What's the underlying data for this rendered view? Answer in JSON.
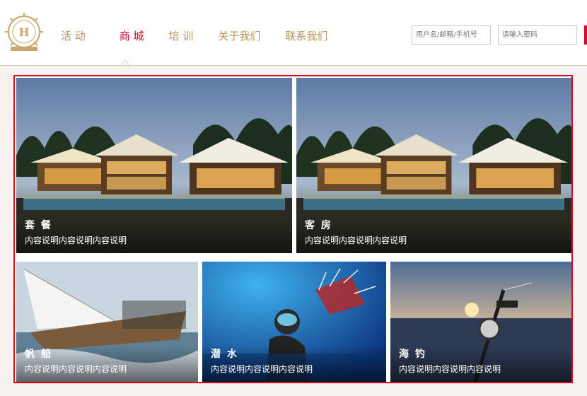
{
  "nav": {
    "items": [
      {
        "label": "活 动",
        "active": false
      },
      {
        "label": "商 城",
        "active": true
      },
      {
        "label": "培 训",
        "active": false
      },
      {
        "label": "关于我们",
        "active": false
      },
      {
        "label": "联系我们",
        "active": false
      }
    ]
  },
  "login": {
    "username_placeholder": "用户名/邮箱/手机号",
    "password_placeholder": "请输入密码"
  },
  "tiles": [
    {
      "title": "套 餐",
      "desc": "内容说明内容说明内容说明"
    },
    {
      "title": "客 房",
      "desc": "内容说明内容说明内容说明"
    },
    {
      "title": "帆 船",
      "desc": "内容说明内容说明内容说明"
    },
    {
      "title": "潜 水",
      "desc": "内容说明内容说明内容说明"
    },
    {
      "title": "海 钓",
      "desc": "内容说明内容说明内容说明"
    }
  ],
  "colors": {
    "accent": "#c8102e",
    "nav_text": "#b8955a",
    "border": "#d0111b"
  }
}
